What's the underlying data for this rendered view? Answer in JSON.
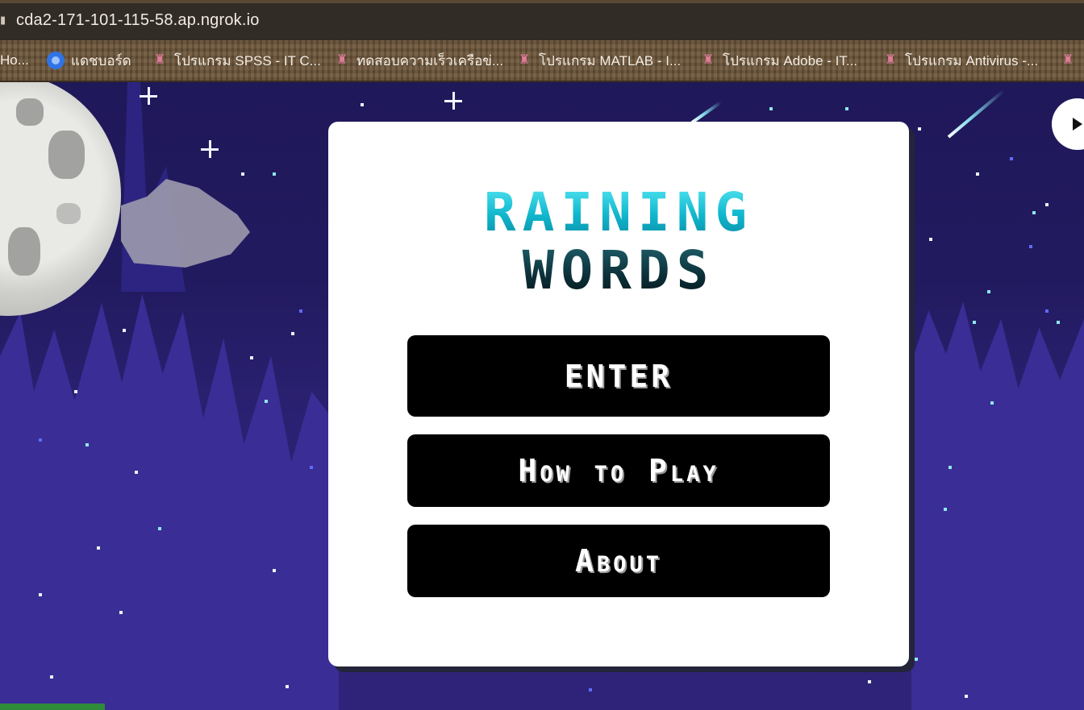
{
  "browser": {
    "url": "cda2-171-101-115-58.ap.ngrok.io",
    "bookmarks": [
      {
        "label": "Ho...",
        "icon": "page-icon"
      },
      {
        "label": "แดชบอร์ด",
        "icon": "dashboard-icon"
      },
      {
        "label": "โปรแกรม SPSS - IT C...",
        "icon": "shield-icon"
      },
      {
        "label": "ทดสอบความเร็วเครือข่...",
        "icon": "shield-icon"
      },
      {
        "label": "โปรแกรม MATLAB - I...",
        "icon": "shield-icon"
      },
      {
        "label": "โปรแกรม Adobe - IT...",
        "icon": "shield-icon"
      },
      {
        "label": "โปรแกรม Antivirus -...",
        "icon": "shield-icon"
      }
    ]
  },
  "game": {
    "title_line1": "Raining",
    "title_line2": "Words",
    "buttons": {
      "enter": "Enter",
      "how_to_play": "How to Play",
      "about": "About"
    },
    "colors": {
      "sky": "#2a1f70",
      "title_top": "#12c2d6",
      "title_bottom": "#0f3b44",
      "button_bg": "#000000"
    }
  }
}
